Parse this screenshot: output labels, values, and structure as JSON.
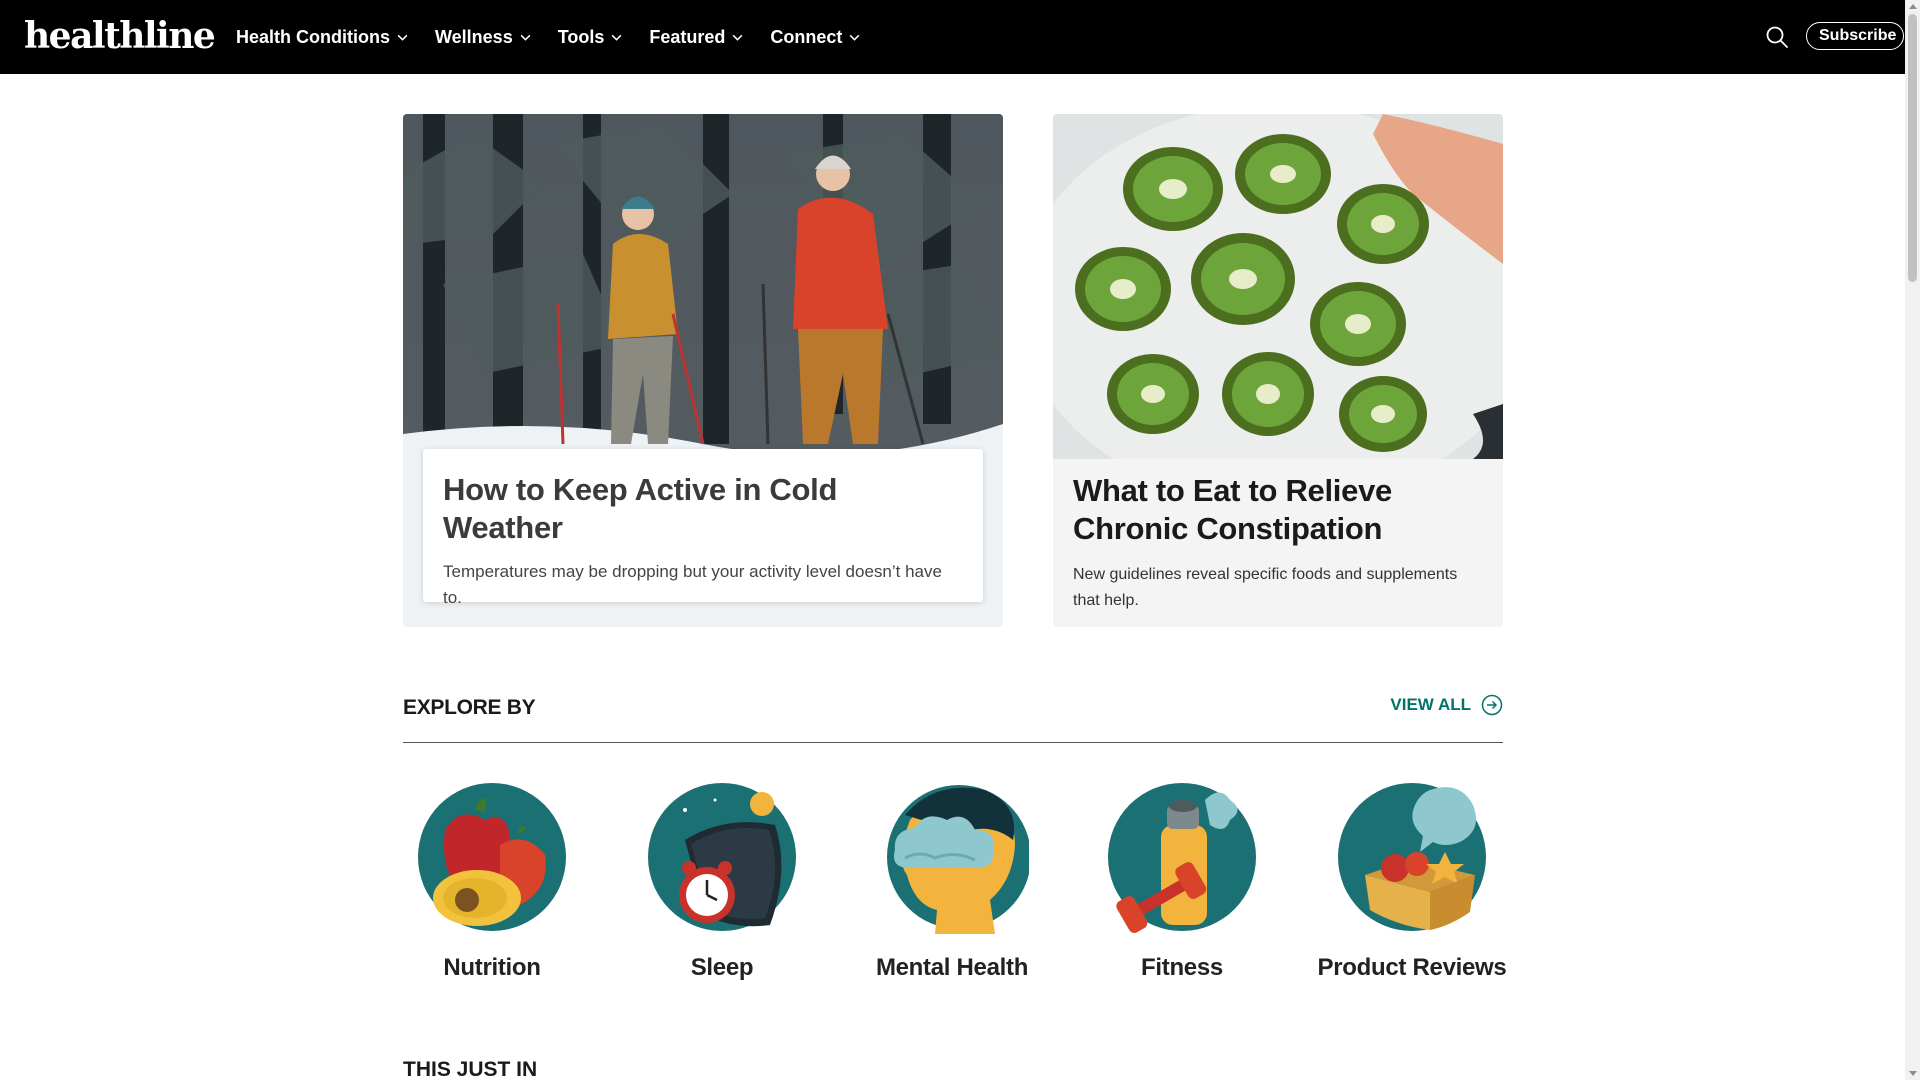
{
  "header": {
    "logo": "healthline",
    "nav": [
      {
        "label": "Health Conditions"
      },
      {
        "label": "Wellness"
      },
      {
        "label": "Tools"
      },
      {
        "label": "Featured"
      },
      {
        "label": "Connect"
      }
    ],
    "subscribe_label": "Subscribe",
    "search_icon": "search-icon"
  },
  "hero": [
    {
      "title": "How to Keep Active in Cold Weather",
      "description": "Temperatures may be dropping but your activity level doesn’t have to.",
      "image": "snowshoe-hikers-photo"
    },
    {
      "title": "What to Eat to Relieve Chronic Constipation",
      "description": "New guidelines reveal specific foods and supplements that help.",
      "image": "kiwi-halves-photo"
    }
  ],
  "explore": {
    "title": "EXPLORE BY",
    "view_all_label": "VIEW ALL",
    "categories": [
      {
        "label": "Nutrition",
        "icon": "nutrition-icon"
      },
      {
        "label": "Sleep",
        "icon": "sleep-icon"
      },
      {
        "label": "Mental Health",
        "icon": "mental-health-icon"
      },
      {
        "label": "Fitness",
        "icon": "fitness-icon"
      },
      {
        "label": "Product Reviews",
        "icon": "product-reviews-icon"
      }
    ]
  },
  "just_in": {
    "title": "THIS JUST IN"
  },
  "colors": {
    "header_bg": "#000000",
    "accent_teal": "#00746b",
    "icon_teal": "#1b7074",
    "card_bg": "#f4f4f4"
  }
}
